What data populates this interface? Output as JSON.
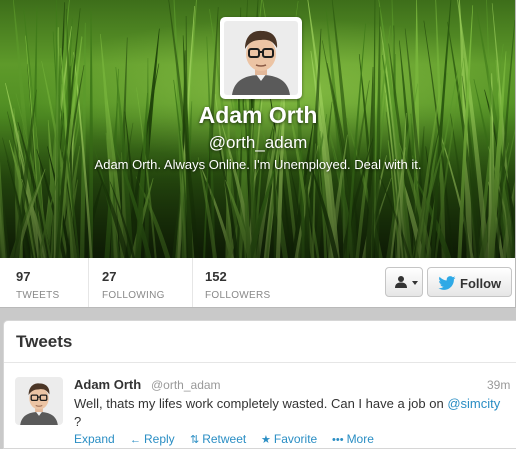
{
  "profile": {
    "fullname": "Adam Orth",
    "screenname": "@orth_adam",
    "bio": "Adam Orth. Always Online. I'm Unemployed. Deal with it."
  },
  "stats": [
    {
      "count": "97",
      "label": "TWEETS"
    },
    {
      "count": "27",
      "label": "FOLLOWING"
    },
    {
      "count": "152",
      "label": "FOLLOWERS"
    }
  ],
  "buttons": {
    "follow_label": "Follow",
    "user_actions_icon": "person-icon"
  },
  "tweets_section": {
    "title": "Tweets",
    "items": [
      {
        "name": "Adam Orth",
        "handle": "@orth_adam",
        "time": "39m",
        "text_before": "Well, thats my lifes work completely wasted. Can I have a job on ",
        "mention": "@simcity",
        "text_after": " ?",
        "actions": [
          "Expand",
          "Reply",
          "Retweet",
          "Favorite",
          "More"
        ]
      }
    ]
  },
  "colors": {
    "link": "#2a8ec4",
    "twitter_blue": "#2fa9e6",
    "banner_green": "#4f8d22"
  }
}
